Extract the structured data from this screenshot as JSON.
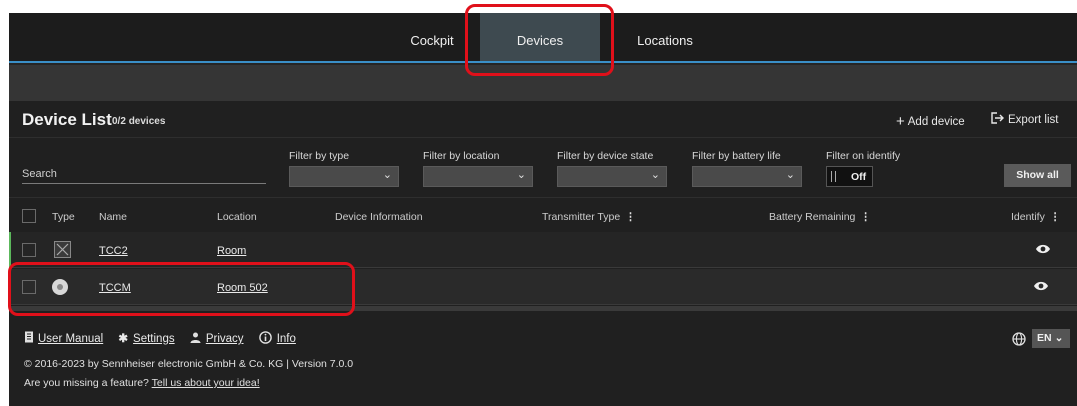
{
  "nav": {
    "tabs": [
      {
        "label": "Cockpit",
        "active": false
      },
      {
        "label": "Devices",
        "active": true
      },
      {
        "label": "Locations",
        "active": false
      }
    ]
  },
  "device_list": {
    "title": "Device List",
    "count": "0/2",
    "count_suffix": "devices",
    "add_device": "Add device",
    "export_list": "Export list"
  },
  "filters": {
    "search_placeholder": "Search",
    "by_type": "Filter by type",
    "by_location": "Filter by location",
    "by_state": "Filter by device state",
    "by_battery": "Filter by battery life",
    "on_identify": "Filter on identify",
    "identify_toggle": "Off",
    "show_all": "Show all"
  },
  "columns": {
    "type": "Type",
    "name": "Name",
    "location": "Location",
    "device_information": "Device Information",
    "transmitter_type": "Transmitter Type",
    "battery_remaining": "Battery Remaining",
    "identify": "Identify"
  },
  "rows": [
    {
      "type_icon": "unknown-device-icon",
      "name": "TCC2",
      "location": "Room"
    },
    {
      "type_icon": "ceiling-mic-icon",
      "name": "TCCM",
      "location": "Room 502"
    }
  ],
  "footer": {
    "user_manual": "User Manual",
    "settings": "Settings",
    "privacy": "Privacy",
    "info": "Info",
    "copyright": "© 2016-2023 by Sennheiser electronic GmbH & Co. KG | Version 7.0.0",
    "feature_question": "Are you missing a feature?",
    "feature_link": "Tell us about your idea!",
    "language": "EN"
  },
  "colors": {
    "annotation": "#e0101a",
    "active_tab": "#3e4a50",
    "nav_underline": "#3a8fc7",
    "online_indicator": "#5cb85c"
  }
}
